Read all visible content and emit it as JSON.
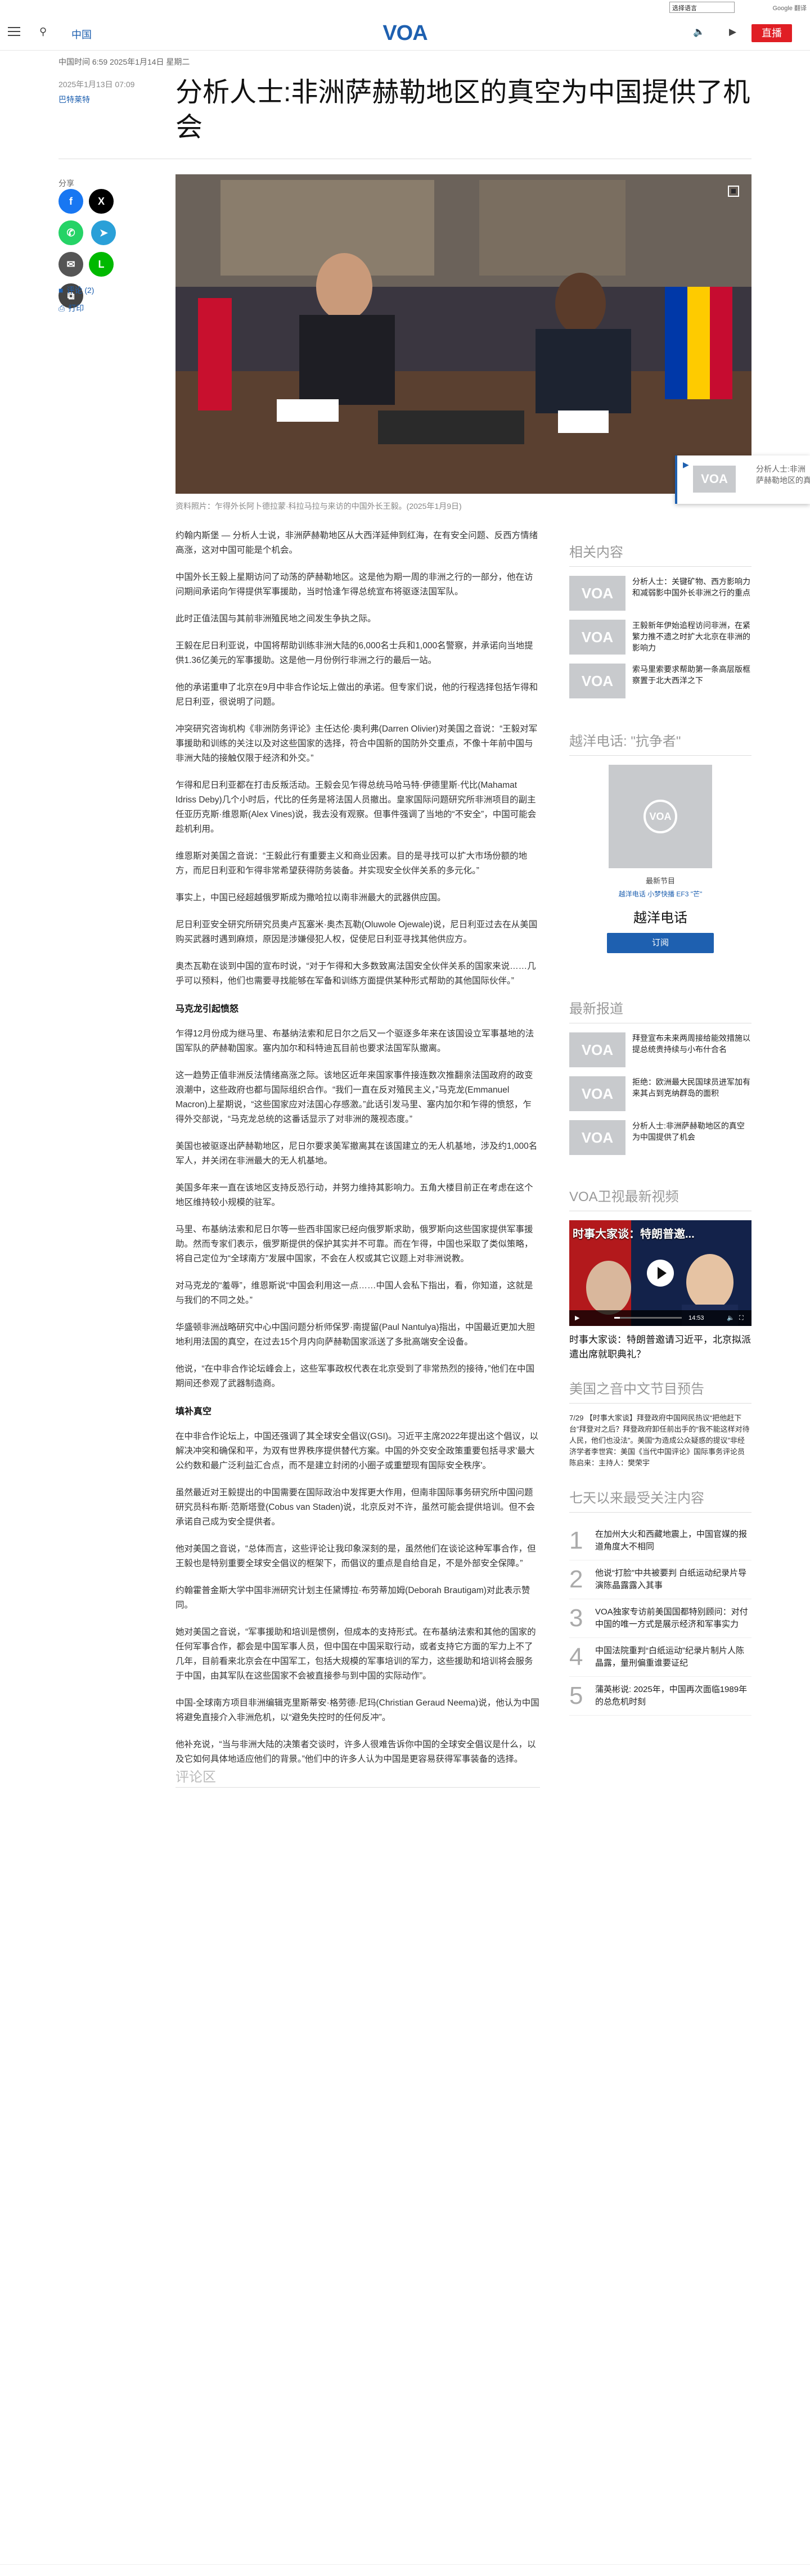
{
  "util": {
    "language_select": "选择语言",
    "google": "Google 翻译"
  },
  "header": {
    "section": "中国",
    "logo": "VOA",
    "live_label": "直播"
  },
  "dateline": "中国时间 6:59 2025年1月14日 星期二",
  "meta": {
    "date": "2025年1月13日 07:09",
    "author": "巴特莱特"
  },
  "headline": "分析人士:非洲萨赫勒地区的真空为中国提供了机会",
  "share": {
    "label": "分享",
    "comments": "评论 (2)",
    "print": "打印"
  },
  "hero": {
    "caption": "资料照片：乍得外长阿卜德拉蒙·科拉马拉与来访的中国外长王毅。(2025年1月9日)"
  },
  "float_card": {
    "text": "分析人士:非洲萨赫勒地区的真空为中国提供了机会"
  },
  "article": {
    "p1": "约翰内斯堡 — 分析人士说，非洲萨赫勒地区从大西洋延伸到红海，在有安全问题、反西方情绪高涨，这对中国可能是个机会。",
    "p2": "中国外长王毅上星期访问了动荡的萨赫勒地区。这是他为期一周的非洲之行的一部分，他在访问期间承诺向乍得提供军事援助，当时恰逢乍得总统宣布将驱逐法国军队。",
    "p3": "此时正值法国与其前非洲殖民地之间发生争执之际。",
    "p4": "王毅在尼日利亚说，中国将帮助训练非洲大陆的6,000名士兵和1,000名警察，并承诺向当地提供1.36亿美元的军事援助。这是他一月份例行非洲之行的最后一站。",
    "p5": "他的承诺重申了北京在9月中非合作论坛上做出的承诺。但专家们说，他的行程选择包括乍得和尼日利亚，很说明了问题。",
    "p6": "冲突研究咨询机构《非洲防务评论》主任达伦·奥利弗(Darren Olivier)对美国之音说：“王毅对军事援助和训练的关注以及对这些国家的选择，符合中国新的国防外交重点，不像十年前中国与非洲大陆的接触仅限于经济和外交。”",
    "p7": "乍得和尼日利亚都在打击反叛活动。王毅会见乍得总统马哈马特·伊德里斯·代比(Mahamat Idriss Deby)几个小时后，代比的任务是将法国人员撤出。皇家国际问题研究所非洲项目的副主任亚历克斯·维恩斯(Alex Vines)说，我去没有观察。但事件强调了当地的“不安全”，中国可能会趁机利用。",
    "p8": "维恩斯对美国之音说：“王毅此行有重要主义和商业因素。目的是寻找可以扩大市场份额的地方，而尼日利亚和乍得非常希望获得防务装备。并实现安全伙伴关系的多元化。”",
    "p9": "事实上，中国已经超越俄罗斯成为撒哈拉以南非洲最大的武器供应国。",
    "p10": "尼日利亚安全研究所研究员奥卢瓦塞米·奥杰瓦勒(Oluwole Ojewale)说，尼日利亚过去在从美国购买武器时遇到麻烦，原因是涉嫌侵犯人权，促使尼日利亚寻找其他供应方。",
    "p11": "奥杰瓦勒在谈到中国的宣布时说，“对于乍得和大多数致离法国安全伙伴关系的国家来说……几乎可以预料，他们也需要寻找能够在军备和训练方面提供某种形式帮助的其他国际伙伴。”",
    "h1": "马克龙引起愤怒",
    "p12": "乍得12月份成为继马里、布基纳法索和尼日尔之后又一个驱逐多年来在该国设立军事基地的法国军队的萨赫勒国家。塞内加尔和科特迪瓦目前也要求法国军队撤离。",
    "p13": "这一趋势正值非洲反法情绪高涨之际。该地区近年来国家事件接连数次推翻亲法国政府的政变浪潮中，这些政府也都与国际组织合作。“我们一直在反对殖民主义，”马克龙(Emmanuel Macron)上星期说，“这些国家应对法国心存感激。”此话引发马里、塞内加尔和乍得的愤怒，乍得外交部说，“马克龙总统的这番话显示了对非洲的蔑视态度。”",
    "p14": "美国也被驱逐出萨赫勒地区，尼日尔要求美军撤离其在该国建立的无人机基地，涉及约1,000名军人，并关闭在非洲最大的无人机基地。",
    "p15": "美国多年来一直在该地区支持反恐行动，并努力维持其影响力。五角大楼目前正在考虑在这个地区维持较小规模的驻军。",
    "p16": "马里、布基纳法索和尼日尔等一些西非国家已经向俄罗斯求助，俄罗斯向这些国家提供军事援助。然而专家们表示，俄罗斯提供的保护其实并不可靠。而在乍得，中国也采取了类似策略，将自己定位为“全球南方”发展中国家，不会在人权或其它议题上对非洲说教。",
    "p17": "对马克龙的“羞辱”，维恩斯说“中国会利用这一点……中国人会私下指出，看，你知道，这就是与我们的不同之处。”",
    "p18": "华盛顿非洲战略研究中心中国问题分析师保罗·南提留(Paul Nantulya)指出，中国最近更加大胆地利用法国的真空，在过去15个月内向萨赫勒国家派送了多批高端安全设备。",
    "p19": "他说，“在中非合作论坛峰会上，这些军事政权代表在北京受到了非常热烈的接待，”他们在中国期间还参观了武器制造商。",
    "h2": "填补真空",
    "p20": "在中非合作论坛上，中国还强调了其全球安全倡议(GSI)。习近平主席2022年提出这个倡议，以解决冲突和确保和平，为双有世界秩序提供替代方案。中国的外交安全政策重要包括寻求'最大公约数和最广泛利益汇合点，而不是建立封闭的小圈子或重塑现有国际安全秩序'。",
    "p21": "虽然最近对王毅提出的中国需要在国际政治中发挥更大作用，但南非国际事务研究所中国问题研究员科布斯·范斯塔登(Cobus van Staden)说，北京反对不许，虽然可能会提供培训。但不会承诺自己成为安全提供者。",
    "p22": "他对美国之音说，“总体而言，这些评论让我印象深刻的是，虽然他们在谈论这种军事合作，但王毅也是特别重要全球安全倡议的框架下，而倡议的重点是自给自足，不是外部安全保障。”",
    "p23": "约翰霍普金斯大学中国非洲研究计划主任黛博拉·布劳蒂加姆(Deborah Brautigam)对此表示赞同。",
    "p24": "她对美国之音说，“军事援助和培训是惯例，但成本的支持形式。在布基纳法索和其他的国家的任何军事合作，都会是中国军事人员，但中国在中国采取行动，或者支持它方面的军力上不了几年，目前看来北京会在中国军工，包括大规模的军事培训的军力，这些援助和培训将会服务于中国，由其军队在这些国家不会被直接参与到中国的实际动作”。",
    "p25": "中国-全球南方项目非洲编辑克里斯蒂安·格劳德·尼玛(Christian Geraud Neema)说，他认为中国将避免直接介入非洲危机，以“避免失控时的任何反冲”。",
    "p26": "他补充说，“当与非洲大陆的决策者交谈时，许多人很难告诉你中国的全球安全倡议是什么，以及它如何具体地适应他们的背景。”他们中的许多人认为中国是更容易获得军事装备的选择。"
  },
  "comments_title": "评论区",
  "related": {
    "title": "相关内容",
    "items": [
      "分析人士：关键矿物、西方影响力和减弱影中国外长非洲之行的重点",
      "王毅新年伊始追程访问非洲，在紧繁力推不遗之时扩大北京在非洲的影响力",
      "索马里索要求帮助第一条高层版框察置于北大西洋之下"
    ]
  },
  "podcast": {
    "title": "越洋电话: \"抗争者\"",
    "label": "最新节目",
    "links": "越洋电话  小梦快播  EF3 \"芒\"",
    "name": "越洋电话",
    "subscribe": "订阅"
  },
  "latest": {
    "title": "最新报道",
    "items": [
      "拜登宣布未来两周接给能效措施以提总统贵持续与小布什合名",
      "拒绝：欧洲最大民国球员进军加有来其占到克纳群岛的面积",
      "分析人士:非洲萨赫勒地区的真空为中国提供了机会"
    ]
  },
  "video": {
    "title": "VOA卫视最新视频",
    "overlay": "时事大家谈：特朗普邀...",
    "time": "14:53",
    "caption": "时事大家谈：特朗普邀请习近平，北京拟派遣出席就职典礼？"
  },
  "audio": {
    "title": "美国之音中文节目预告",
    "text": "7/29 【时事大家谈】拜登政府中国网民热议“把他赶下台”拜登对之后？拜登政府卸任前出手的“我不能这样对待人民，他们也没法”。美国“为造成公众疑惑的提议”非经济学者李世宾：美国《当代中国评论》国际事务评论员陈启来：主持人：樊荣宇"
  },
  "ranking": {
    "title": "七天以来最受关注内容",
    "items": [
      "在加州大火和西藏地震上，中国官媒的报道角度大不相同",
      "他说“打脸”中共被要判 白纸运动纪录片导演陈晶露露入其事",
      "VOA独家专访前美国国都特别顾问：对付中国的唯一方式是展示经济和军事实力",
      "中国法院重判“白纸运动”纪录片制片人陈晶露，量刑偏重谁要证纪",
      "蒲英彬说: 2025年，中国再次面临1989年的总危机时刻"
    ]
  }
}
